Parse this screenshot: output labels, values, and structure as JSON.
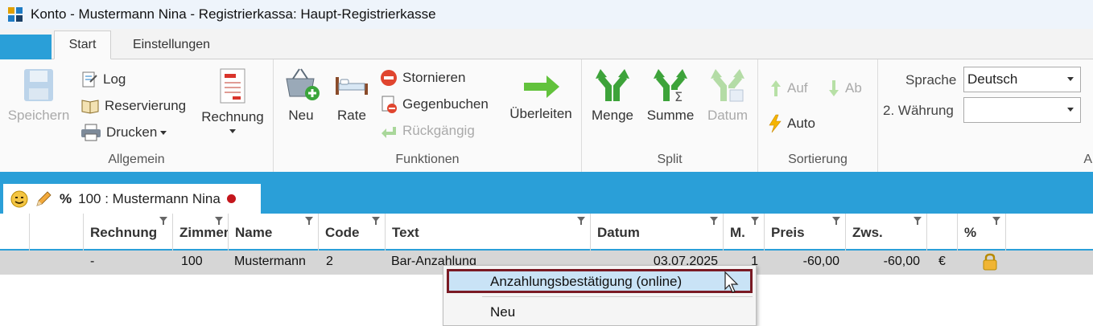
{
  "window": {
    "title": "Konto - Mustermann Nina - Registrierkassa: Haupt-Registrierkasse"
  },
  "ribbon_tabs": {
    "start": "Start",
    "settings": "Einstellungen"
  },
  "ribbon": {
    "allgemein": {
      "label": "Allgemein",
      "save": "Speichern",
      "log": "Log",
      "reservation": "Reservierung",
      "print": "Drucken",
      "invoice": "Rechnung"
    },
    "funktionen": {
      "label": "Funktionen",
      "new": "Neu",
      "rate": "Rate",
      "cancel": "Stornieren",
      "counter_book": "Gegenbuchen",
      "undo": "Rückgängig",
      "transfer": "Überleiten"
    },
    "split": {
      "label": "Split",
      "quantity": "Menge",
      "sum": "Summe",
      "date": "Datum"
    },
    "sortierung": {
      "label": "Sortierung",
      "up": "Auf",
      "down": "Ab",
      "auto": "Auto"
    },
    "ansicht": {
      "label_partial": "Ans",
      "language_label": "Sprache",
      "language_value": "Deutsch",
      "currency2_label": "2. Währung",
      "currency2_value": ""
    }
  },
  "doc_tab": {
    "label": "100 :  Mustermann Nina",
    "percent": "%"
  },
  "columns": [
    "Rechnung",
    "Zimmer",
    "Name",
    "Code",
    "Text",
    "Datum",
    "M.",
    "Preis",
    "Zws.",
    "",
    "%"
  ],
  "row": {
    "rechnung": "-",
    "zimmer": "100",
    "name": "Mustermann",
    "code": "2",
    "text": "Bar-Anzahlung",
    "datum": "03.07.2025",
    "m": "1",
    "preis": "-60,00",
    "zws": "-60,00",
    "currency": "€"
  },
  "context_menu": {
    "item1": "Anzahlungsbestätigung (online)",
    "item2": "Neu"
  },
  "colors": {
    "accent": "#2a9fd8",
    "highlight_border": "#7a1a24"
  }
}
